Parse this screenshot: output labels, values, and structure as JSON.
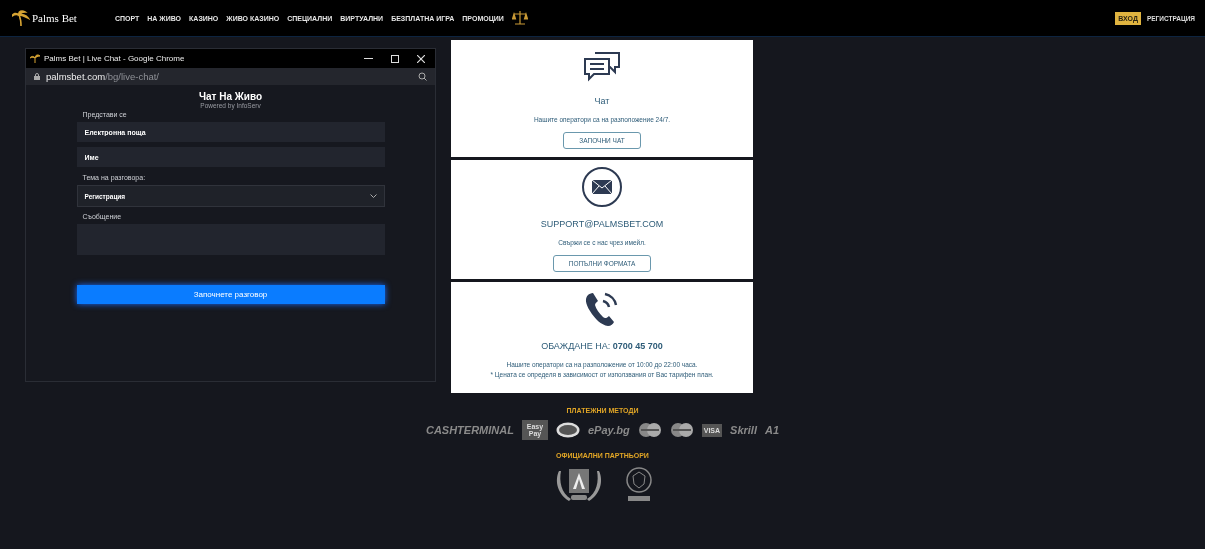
{
  "header": {
    "logo": "Palms Bet",
    "nav": [
      "СПОРТ",
      "НА ЖИВО",
      "КАЗИНО",
      "ЖИВО КАЗИНО",
      "СПЕЦИАЛНИ",
      "ВИРТУАЛНИ",
      "БЕЗПЛАТНА ИГРА",
      "ПРОМОЦИИ"
    ],
    "login": "ВХОД",
    "register": "РЕГИСТРАЦИЯ"
  },
  "chat_window": {
    "title": "Palms Bet | Live Chat - Google Chrome",
    "url_host": "palmsbet.com",
    "url_path": "/bg/live-chat/",
    "heading": "Чат На Живо",
    "powered": "Powered by InfoServ",
    "intro_label": "Представи се",
    "fields": [
      {
        "placeholder": "Електронна поща"
      },
      {
        "placeholder": "Име"
      }
    ],
    "topic_label": "Тема на разговора:",
    "topic_value": "Регистрация",
    "message_label": "Съобщение",
    "submit": "Започнете разговор"
  },
  "contact_cards": [
    {
      "kind": "chat",
      "title": "Чат",
      "lines": [
        "Нашите оператори са на разположение 24/7."
      ],
      "button": "ЗАПОЧНИ ЧАТ"
    },
    {
      "kind": "email",
      "title": "SUPPORT@PALMSBET.COM",
      "lines": [
        "Свържи се с нас чрез имейл."
      ],
      "button": "ПОПЪЛНИ ФОРМАТА"
    },
    {
      "kind": "phone",
      "title": "ОБАЖДАНЕ НА: **0700 45 700**",
      "lines": [
        "Нашите оператори са на разположение от 10:00 до 22:00 часа.",
        "* Цената се определя в зависимост от използвания от Вас тарифен план."
      ]
    }
  ],
  "footer": {
    "payments_title": "ПЛАТЕЖНИ МЕТОДИ",
    "payment_logos": [
      {
        "kind": "wordmark",
        "label": "CASHTERMINAL"
      },
      {
        "kind": "box",
        "label": "Easy Pay"
      },
      {
        "kind": "oval"
      },
      {
        "kind": "wordmark",
        "label": "ePay.bg"
      },
      {
        "kind": "circles"
      },
      {
        "kind": "circles"
      },
      {
        "kind": "box",
        "label": "VISA"
      },
      {
        "kind": "wordmark",
        "label": "Skrill"
      },
      {
        "kind": "wordmark",
        "label": "A1"
      }
    ],
    "partners_title": "ОФИЦИАЛНИ ПАРТНЬОРИ"
  }
}
